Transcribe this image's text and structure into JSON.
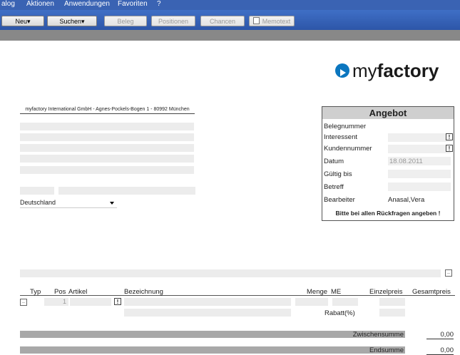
{
  "menubar": {
    "items": [
      "alog",
      "Aktionen",
      "Anwendungen",
      "Favoriten",
      "?"
    ]
  },
  "toolbar": {
    "new_label": "Neu▾",
    "search_label": "Suchen▾",
    "beleg_label": "Beleg",
    "positionen_label": "Positionen",
    "chancen_label": "Chancen",
    "memotext_label": "Memotext"
  },
  "logo": {
    "prefix": "my",
    "suffix": "factory"
  },
  "sender_line": "myfactory International GmbH - Agnes-Pockels-Bogen 1 - 80992 München",
  "address": {
    "country": "Deutschland"
  },
  "offer_box": {
    "title": "Angebot",
    "labels": {
      "belegnummer": "Belegnummer",
      "interessent": "Interessent",
      "kundennummer": "Kundennummer",
      "datum": "Datum",
      "gueltig_bis": "Gültig bis",
      "betreff": "Betreff",
      "bearbeiter": "Bearbeiter"
    },
    "datum_value": "18.08.2011",
    "bearbeiter_value": "Anasal,Vera",
    "hint": "Bitte bei allen Rückfragen angeben !"
  },
  "positions": {
    "columns": {
      "typ": "Typ",
      "pos": "Pos",
      "artikel": "Artikel",
      "bezeichnung": "Bezeichnung",
      "menge": "Menge",
      "me": "ME",
      "einzelpreis": "Einzelpreis",
      "gesamtpreis": "Gesamtpreis"
    },
    "first_row_pos": "1",
    "rabatt_label": "Rabatt(%)"
  },
  "totals": {
    "zwischensumme_label": "Zwischensumme",
    "zwischensumme_value": "0,00",
    "endsumme_label": "Endsumme",
    "endsumme_value": "0,00"
  },
  "colors": {
    "toolbar": "#2d56a8",
    "logo_blue": "#0b76bf",
    "band_gray": "#888888"
  }
}
